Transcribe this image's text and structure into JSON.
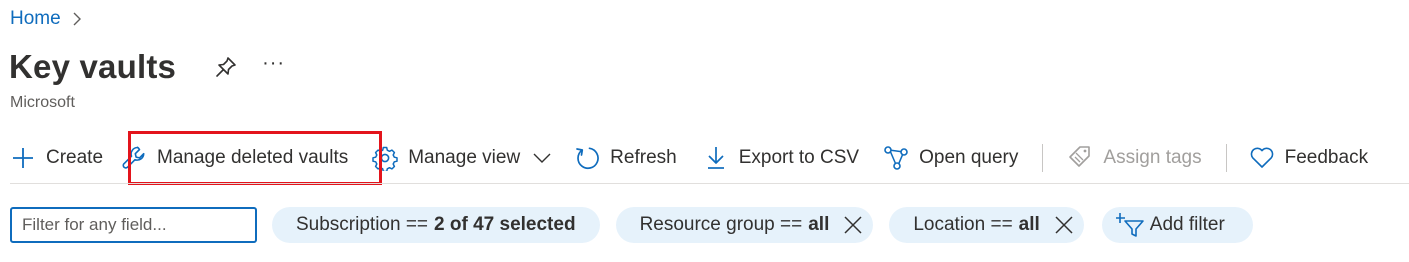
{
  "breadcrumb": {
    "home": "Home"
  },
  "header": {
    "title": "Key vaults",
    "more": "···",
    "subtitle": "Microsoft"
  },
  "toolbar": {
    "create": "Create",
    "manage_deleted": "Manage deleted vaults",
    "manage_view": "Manage view",
    "refresh": "Refresh",
    "export_csv": "Export to CSV",
    "open_query": "Open query",
    "assign_tags": "Assign tags",
    "feedback": "Feedback"
  },
  "filters": {
    "search_placeholder": "Filter for any field...",
    "subscription": {
      "label": "Subscription ==",
      "value": "2 of 47 selected"
    },
    "resource_group": {
      "label": "Resource group ==",
      "value": "all"
    },
    "location": {
      "label": "Location ==",
      "value": "all"
    },
    "add_filter": "Add filter"
  },
  "colors": {
    "accent": "#0f6cbd",
    "highlight": "#e3141c",
    "pill_bg": "#e6f2fb"
  },
  "icons": [
    "chevron-right-icon",
    "pin-icon",
    "plus-icon",
    "wrench-icon",
    "gear-icon",
    "chevron-down-icon",
    "refresh-icon",
    "download-icon",
    "query-icon",
    "tag-icon",
    "heart-icon",
    "close-icon",
    "add-filter-icon"
  ]
}
